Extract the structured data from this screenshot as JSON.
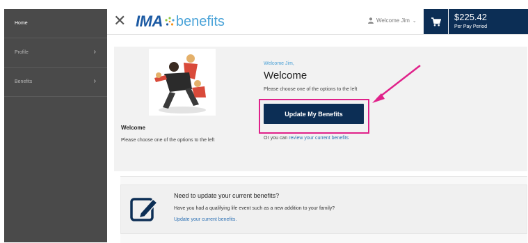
{
  "sidebar": {
    "items": [
      {
        "label": "Home",
        "chevron": false,
        "active": true
      },
      {
        "label": "Profile",
        "chevron": true,
        "active": false
      },
      {
        "label": "Benefits",
        "chevron": true,
        "active": false
      }
    ]
  },
  "header": {
    "logo_ima": "IMA",
    "logo_benefits": "benefits",
    "welcome_user": "Welcome Jim",
    "total": "$225.42",
    "total_period": "Per Pay Period"
  },
  "welcome_card": {
    "left_title": "Welcome",
    "left_text": "Please choose one of the options to the left",
    "greeting": "Welcome Jim,",
    "title": "Welcome",
    "choose_text": "Please choose one of the options to the left",
    "cta_label": "Update My Benefits",
    "alt_prefix": "Or you can",
    "alt_link": "review your current benefits"
  },
  "update_panel": {
    "title": "Need to update your current benefits?",
    "text": "Have you had a qualifying life event such as a new addition to your family?",
    "link": "Update your current benefits."
  },
  "colors": {
    "sidebar": "#4a4a4a",
    "navy": "#0c2e55",
    "highlight": "#e0218a",
    "link": "#2a6fb3"
  }
}
